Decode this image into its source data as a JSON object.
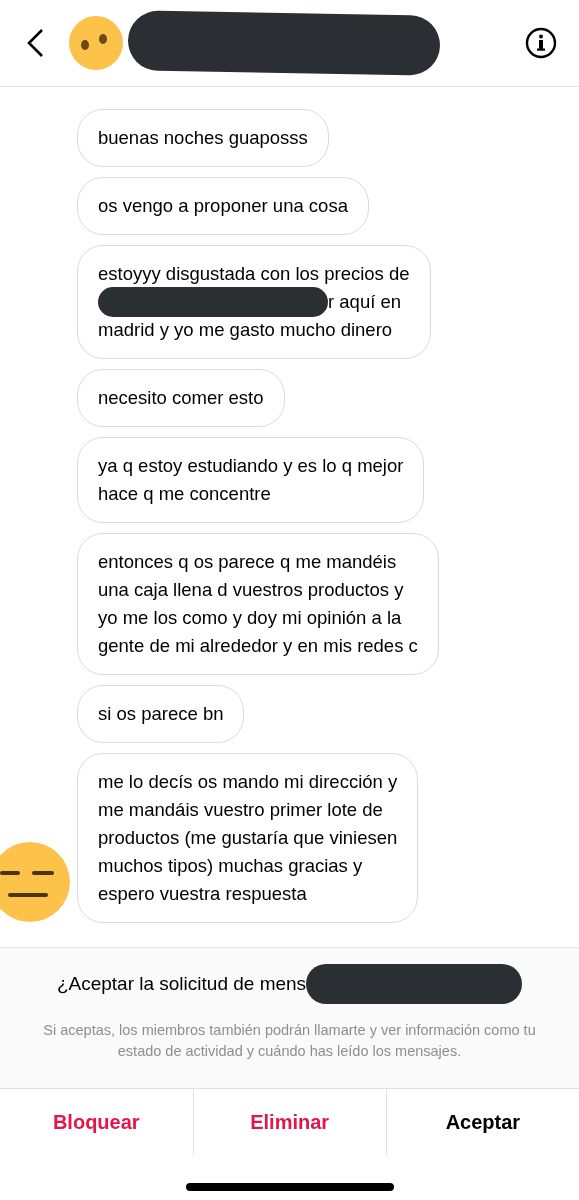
{
  "header": {
    "redacted_name": true
  },
  "messages": [
    {
      "kind": "plain",
      "text": "buenas noches guaposss"
    },
    {
      "kind": "plain",
      "text": "os vengo a proponer una cosa"
    },
    {
      "kind": "redacted",
      "lines": [
        "estoyyy disgustada con los precios de",
        "r aquí en",
        "madrid y yo me gasto mucho dinero"
      ]
    },
    {
      "kind": "plain",
      "text": "necesito comer esto"
    },
    {
      "kind": "plain",
      "text": "ya q estoy estudiando y es lo q mejor\nhace q me concentre"
    },
    {
      "kind": "plain",
      "text": "entonces q os parece q me mandéis\nuna caja llena d vuestros productos y\nyo me los como y doy mi opinión a la\ngente de mi alrededor y en mis redes c"
    },
    {
      "kind": "plain",
      "text": "si os parece bn"
    },
    {
      "kind": "plain",
      "text": "me lo decís os mando mi dirección y\nme mandáis vuestro primer lote de\nproductos (me gustaría que viniesen\nmuchos tipos) muchas gracias y\nespero vuestra respuesta",
      "avatar": true
    }
  ],
  "request": {
    "title": "¿Aceptar la solicitud de mens",
    "note": "Si aceptas, los miembros también podrán llamarte y ver información como tu estado de actividad y cuándo has leído los mensajes."
  },
  "actions": [
    {
      "label": "Bloquear",
      "kind": "danger"
    },
    {
      "label": "Eliminar",
      "kind": "danger"
    },
    {
      "label": "Aceptar",
      "kind": "normal"
    }
  ]
}
